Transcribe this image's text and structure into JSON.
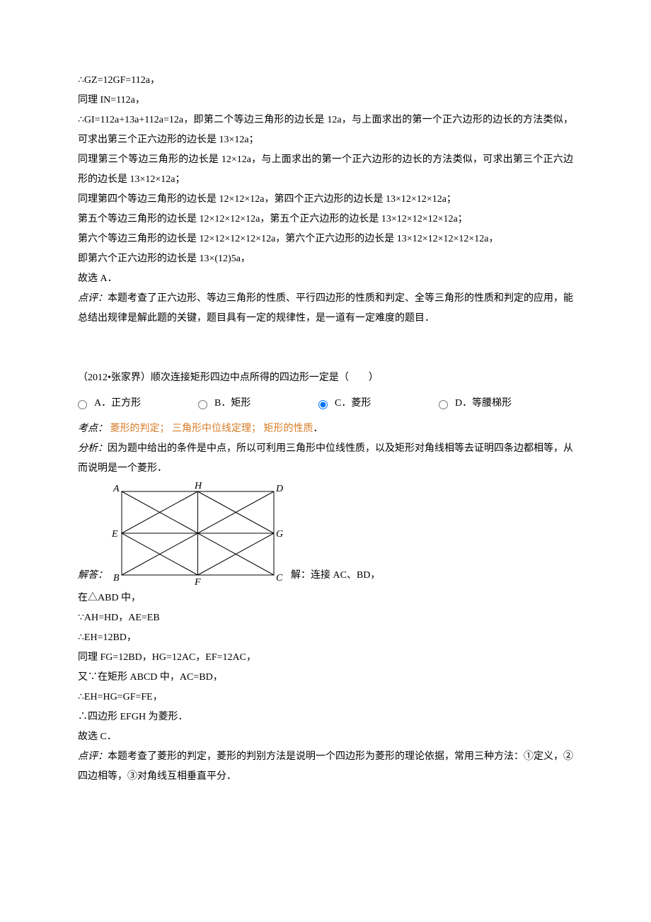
{
  "block1": {
    "l1": "∴GZ=12GF=112a，",
    "l2": "同理 IN=112a，",
    "l3": "∴GI=112a+13a+112a=12a，即第二个等边三角形的边长是 12a，与上面求出的第一个正六边形的边长的方法类似，可求出第三个正六边形的边长是 13×12a；",
    "l4": "同理第三个等边三角形的边长是 12×12a，与上面求出的第一个正六边形的边长的方法类似，可求出第三个正六边形的边长是 13×12×12a；",
    "l5": "同理第四个等边三角形的边长是 12×12×12a，第四个正六边形的边长是 13×12×12×12a；",
    "l6": "第五个等边三角形的边长是 12×12×12×12a，第五个正六边形的边长是 13×12×12×12×12a；",
    "l7": "第六个等边三角形的边长是 12×12×12×12×12a，第六个正六边形的边长是 13×12×12×12×12×12a，",
    "l8": "即第六个正六边形的边长是 13×(12)5a，",
    "l9": "故选 A．",
    "commentLabel": "点评：",
    "comment": "本题考查了正六边形、等边三角形的性质、平行四边形的性质和判定、全等三角形的性质和判定的应用，能总结出规律是解此题的关键，题目具有一定的规律性，是一道有一定难度的题目．"
  },
  "block2": {
    "question": "（2012•张家界）顺次连接矩形四边中点所得的四边形一定是（　　）",
    "options": {
      "A": "A．正方形",
      "B": "B．矩形",
      "C": "C．菱形",
      "D": "D．等腰梯形"
    },
    "kaodianLabel": "考点：",
    "kaodian1": "菱形的判定",
    "kaodian2": "三角形中位线定理",
    "kaodian3": "矩形的性质",
    "fenxiLabel": "分析：",
    "fenxi": "因为题中给出的条件是中点，所以可利用三角形中位线性质，以及矩形对角线相等去证明四条边都相等，从而说明是一个菱形．",
    "jiedaLabel": "解答：",
    "jiedaStart": "解：连接 AC、BD，",
    "s1": "在△ABD 中，",
    "s2": "∵AH=HD，AE=EB",
    "s3": "∴EH=12BD，",
    "s4": "同理 FG=12BD，HG=12AC，EF=12AC，",
    "s5": "又∵在矩形 ABCD 中，AC=BD，",
    "s6": "∴EH=HG=GF=FE，",
    "s7": "∴四边形 EFGH 为菱形．",
    "s8": "故选 C．",
    "dianpingLabel": "点评：",
    "dianping": "本题考查了菱形的判定，菱形的判别方法是说明一个四边形为菱形的理论依据，常用三种方法：①定义，②四边相等，③对角线互相垂直平分．",
    "svgLabels": {
      "A": "A",
      "H": "H",
      "D": "D",
      "E": "E",
      "G": "G",
      "B": "B",
      "F": "F",
      "C": "C"
    }
  }
}
